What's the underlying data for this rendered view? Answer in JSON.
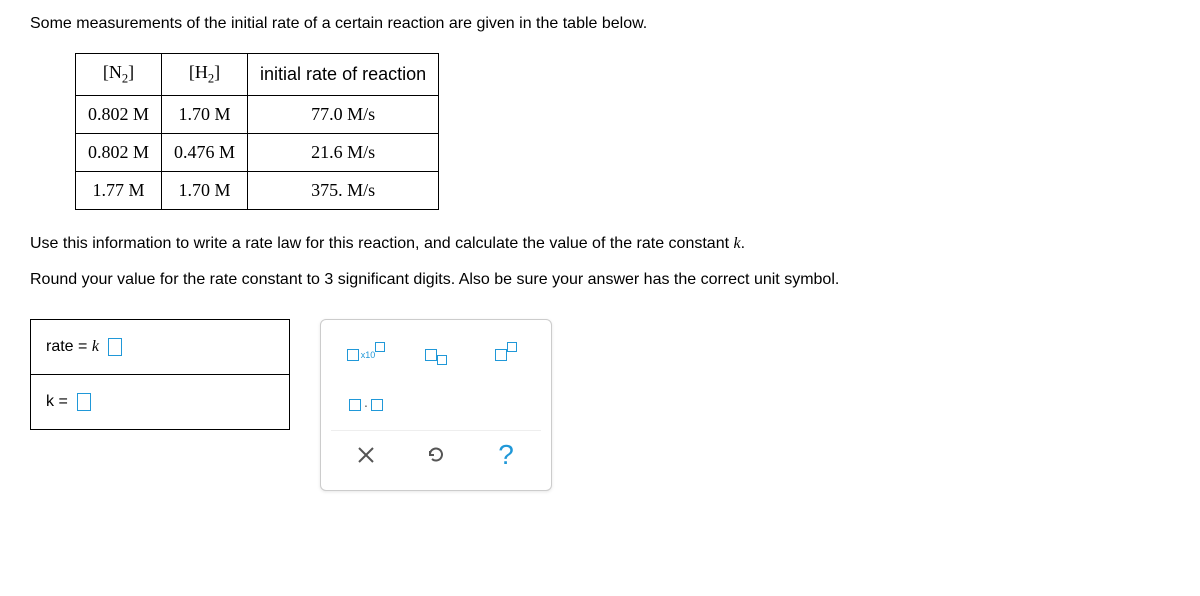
{
  "intro": "Some measurements of the initial rate of a certain reaction are given in the table below.",
  "table": {
    "headers": {
      "col1_pre": "[N",
      "col1_sub": "2",
      "col1_post": "]",
      "col2_pre": "[H",
      "col2_sub": "2",
      "col2_post": "]",
      "col3": "initial rate of reaction"
    },
    "rows": [
      {
        "n2": "0.802 M",
        "h2": "1.70 M",
        "rate": "77.0 M/s"
      },
      {
        "n2": "0.802 M",
        "h2": "0.476 M",
        "rate": "21.6 M/s"
      },
      {
        "n2": "1.77 M",
        "h2": "1.70 M",
        "rate": "375. M/s"
      }
    ]
  },
  "instruction1_pre": "Use this information to write a rate law for this reaction, and calculate the value of the rate constant ",
  "instruction1_k": "k",
  "instruction1_post": ".",
  "instruction2": "Round your value for the rate constant to 3 significant digits. Also be sure your answer has the correct unit symbol.",
  "answer": {
    "rate_label_pre": "rate = ",
    "rate_label_k": "k",
    "k_label": "k = "
  },
  "tools": {
    "x10": "x10",
    "dot": "·"
  }
}
